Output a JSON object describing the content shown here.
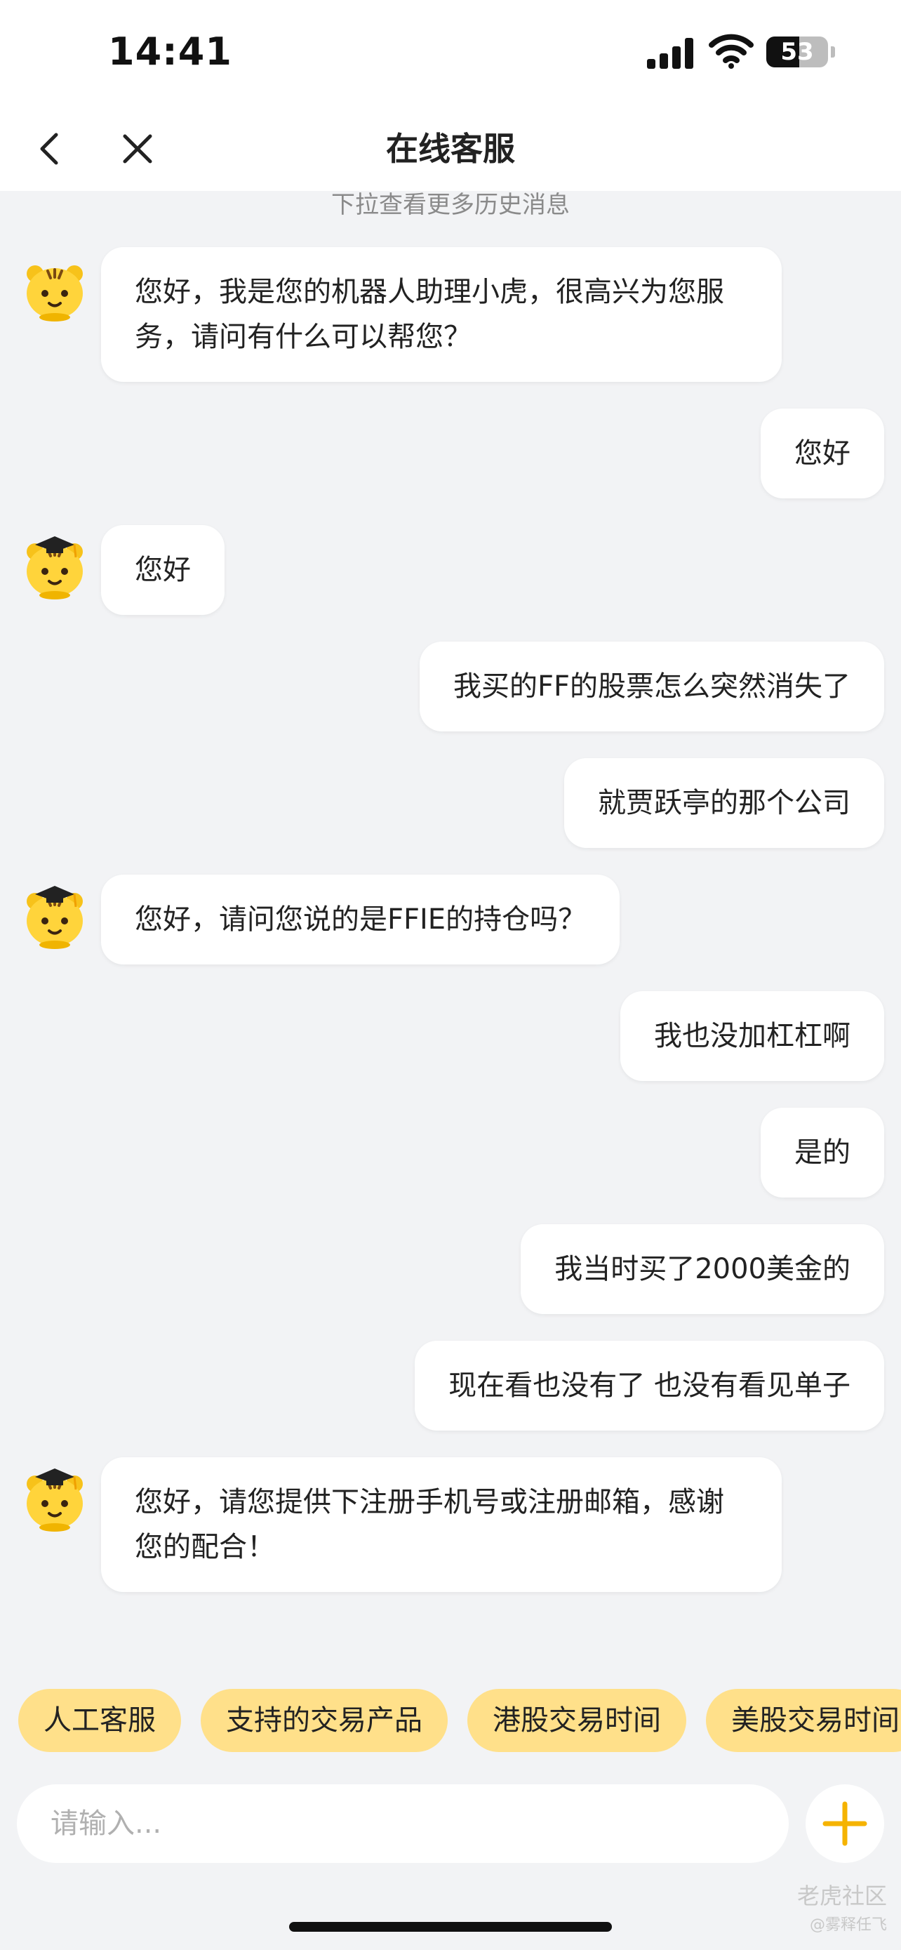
{
  "status_bar": {
    "time": "14:41",
    "battery": "53",
    "battery_level": 0.53
  },
  "nav": {
    "title": "在线客服"
  },
  "history_hint": "下拉查看更多历史消息",
  "messages": [
    {
      "from": "bot",
      "text": "您好，我是您的机器人助理小虎，很高兴为您服务，请问有什么可以帮您？"
    },
    {
      "from": "user",
      "text": "您好"
    },
    {
      "from": "bot",
      "text": "您好"
    },
    {
      "from": "user",
      "text": "我买的FF的股票怎么突然消失了"
    },
    {
      "from": "user",
      "text": "就贾跃亭的那个公司"
    },
    {
      "from": "bot",
      "text": "您好，请问您说的是FFIE的持仓吗？"
    },
    {
      "from": "user",
      "text": "我也没加杠杠啊"
    },
    {
      "from": "user",
      "text": "是的"
    },
    {
      "from": "user",
      "text": "我当时买了2000美金的"
    },
    {
      "from": "user",
      "text": "现在看也没有了 也没有看见单子"
    },
    {
      "from": "bot",
      "text": "您好，请您提供下注册手机号或注册邮箱，感谢您的配合！"
    }
  ],
  "quick_replies": [
    "人工客服",
    "支持的交易产品",
    "港股交易时间",
    "美股交易时间"
  ],
  "input": {
    "placeholder": "请输入..."
  },
  "watermark": {
    "brand": "老虎社区",
    "user": "@雾释任飞"
  },
  "icons": {
    "back": "chevron-left-icon",
    "close": "close-icon",
    "add": "plus-icon",
    "avatar": "tiger-avatar-icon"
  },
  "colors": {
    "accent": "#f5b301",
    "chip_bg": "#ffe08a",
    "page_bg": "#f2f3f5"
  }
}
